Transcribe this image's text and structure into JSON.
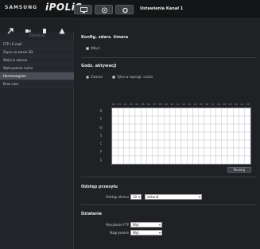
{
  "header": {
    "brand": "SAMSUNG",
    "product": "iPOLiS",
    "page_title": "Ustawienia Kanał 1",
    "icons": [
      "monitor-icon",
      "camera-icon",
      "settings-icon"
    ]
  },
  "sidebar": {
    "subheader": "Zdarzenia",
    "icons": [
      "wrench-icon",
      "video-icon",
      "network-icon",
      "event-icon"
    ],
    "items": [
      {
        "label": "FTP / E-mail",
        "active": false
      },
      {
        "label": "Zapis na karcie SD",
        "active": false
      },
      {
        "label": "Wejście alarmu",
        "active": false
      },
      {
        "label": "Wykrywanie ruchu",
        "active": false
      },
      {
        "label": "Harmonogram",
        "active": true
      },
      {
        "label": "Brak sieci",
        "active": false
      }
    ]
  },
  "main": {
    "section1": {
      "title": "Konfig. zdarz. timera",
      "enable_label": "Włącz"
    },
    "section2": {
      "title": "Godz. aktywacji",
      "radio_always": "Zawsze",
      "radio_schedule": "Tylko w zaprogr. czasie",
      "days": [
        "N",
        "P",
        "W",
        "Ś",
        "C",
        "P",
        "S"
      ],
      "hours": [
        "00",
        "01",
        "02",
        "03",
        "04",
        "05",
        "06",
        "07",
        "08",
        "09",
        "10",
        "11",
        "12",
        "13",
        "14",
        "15",
        "16",
        "17",
        "18",
        "19",
        "20",
        "21",
        "22",
        "23"
      ],
      "reset_label": "Resetuj"
    },
    "section3": {
      "title": "Odstęp przesyłu",
      "interval_label": "Odstęp okresu",
      "interval_value": "10",
      "unit_value": "sekund"
    },
    "section4": {
      "title": "Działanie",
      "ftp_label": "Wysyłanie FTP",
      "ftp_value": "Wył.",
      "record_label": "Nagrywanie",
      "record_value": "Wył."
    },
    "apply_icon": "check-icon"
  }
}
